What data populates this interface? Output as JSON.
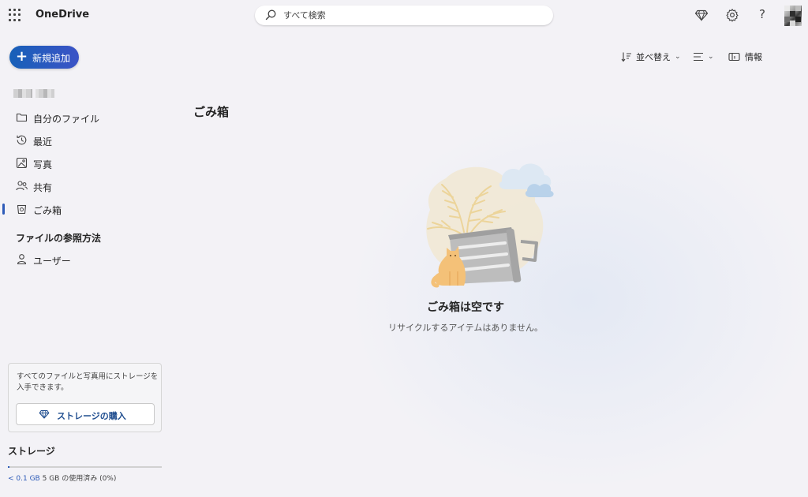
{
  "app": {
    "name": "OneDrive"
  },
  "search": {
    "placeholder": "すべて検索"
  },
  "header_icons": [
    "premium-diamond-icon",
    "settings-gear-icon",
    "help-icon",
    "avatar"
  ],
  "help_glyph": "?",
  "sidebar": {
    "new_button": {
      "label": "新規追加"
    },
    "items": [
      {
        "label": "自分のファイル",
        "icon": "folder-icon"
      },
      {
        "label": "最近",
        "icon": "recent-clock-icon"
      },
      {
        "label": "写真",
        "icon": "photo-icon"
      },
      {
        "label": "共有",
        "icon": "people-icon"
      },
      {
        "label": "ごみ箱",
        "icon": "recycle-bin-icon",
        "active": true
      }
    ],
    "browse_section": {
      "title": "ファイルの参照方法",
      "items": [
        {
          "label": "ユーザー",
          "icon": "person-icon"
        }
      ]
    },
    "promo": {
      "text": "すべてのファイルと写真用にストレージを入手できます。",
      "button_label": "ストレージの購入"
    },
    "storage": {
      "title": "ストレージ",
      "used": "< 0.1 GB",
      "detail": "5 GB の使用済み (0%)",
      "percent_used": 0
    }
  },
  "command_bar": {
    "sort_label": "並べ替え",
    "view_icon": "view-options-icon",
    "info_label": "情報"
  },
  "main": {
    "title": "ごみ箱",
    "empty_state": {
      "title": "ごみ箱は空です",
      "subtitle": "リサイクルするアイテムはありません。"
    }
  },
  "colors": {
    "accent": "#2d5bb8",
    "new_button_start": "#1760b8",
    "new_button_end": "#3b53c6",
    "background": "#f3f2f6"
  }
}
